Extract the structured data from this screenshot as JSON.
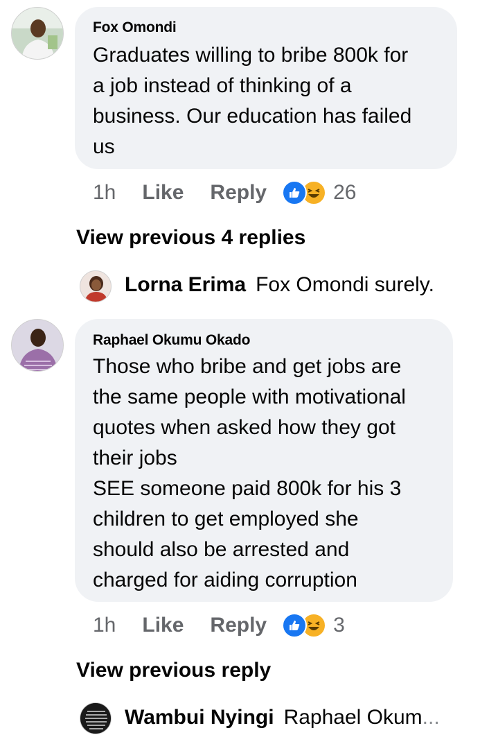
{
  "comments": [
    {
      "author": "Fox Omondi",
      "text_lines": [
        "Graduates willing to bribe 800k for",
        "a job instead of thinking of a",
        "business. Our education has failed",
        "us"
      ],
      "time": "1h",
      "like_label": "Like",
      "reply_label": "Reply",
      "reaction_icons": [
        "like-icon",
        "haha-icon"
      ],
      "reaction_count": "26",
      "view_previous": "View previous 4 replies",
      "reply": {
        "author": "Lorna Erima",
        "text": "Fox Omondi surely."
      }
    },
    {
      "author": "Raphael Okumu Okado",
      "text_lines": [
        "Those who bribe and get jobs are",
        "the same people with motivational",
        "quotes when asked how they got",
        "their jobs",
        "SEE someone paid 800k for his 3",
        "children to get employed she",
        "should also be arrested and",
        "charged for aiding corruption"
      ],
      "time": "1h",
      "like_label": "Like",
      "reply_label": "Reply",
      "reaction_icons": [
        "like-icon",
        "haha-icon"
      ],
      "reaction_count": "3",
      "view_previous": "View previous reply",
      "reply": {
        "author": "Wambui Nyingi",
        "text": "Raphael Okum",
        "ellipsis": "..."
      }
    }
  ],
  "colors": {
    "bubble": "#f0f2f5",
    "meta_text": "#65676b",
    "like_blue": "#1877f2",
    "haha_yellow": "#f7b125"
  }
}
